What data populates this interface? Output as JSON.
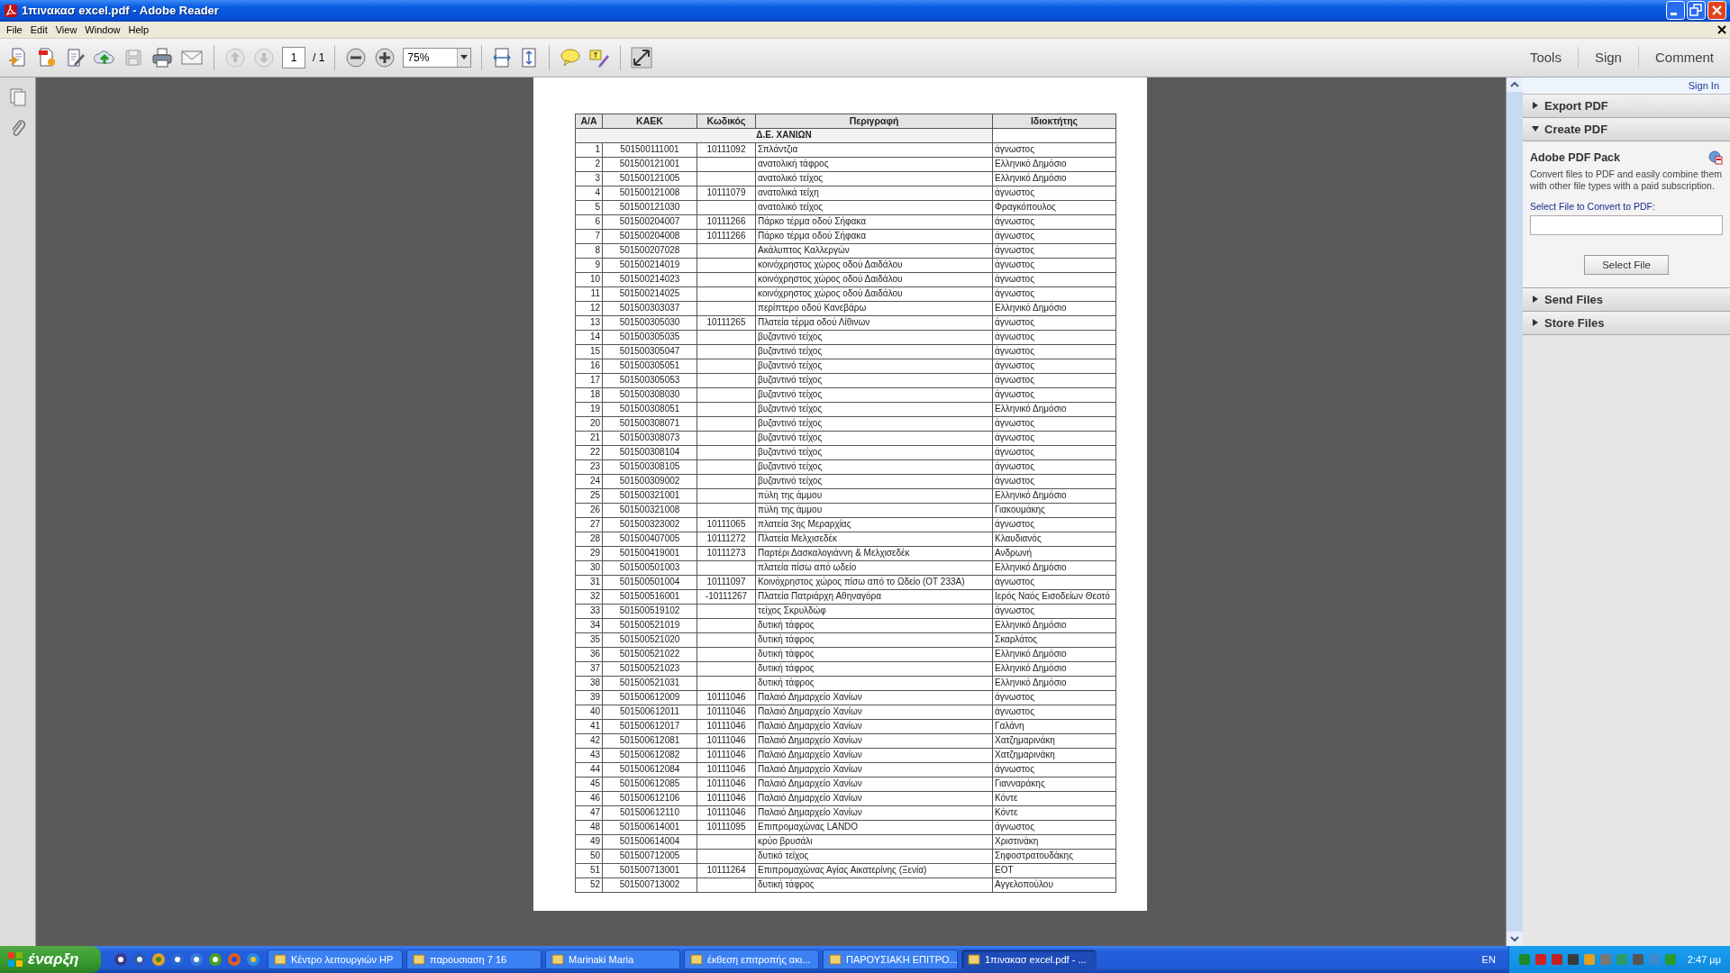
{
  "window": {
    "title": "1πινακασ excel.pdf - Adobe Reader"
  },
  "menu": [
    "File",
    "Edit",
    "View",
    "Window",
    "Help"
  ],
  "toolbar": {
    "page": "1",
    "page_count": "/ 1",
    "zoom": "75%",
    "tabs": [
      "Tools",
      "Sign",
      "Comment"
    ]
  },
  "document": {
    "columns": [
      "Α/Α",
      "ΚΑΕΚ",
      "Κωδικός",
      "Περιγραφή",
      "Ιδιοκτήτης"
    ],
    "group": "Δ.Ε. ΧΑΝΙΩΝ",
    "rows": [
      {
        "n": "1",
        "kaek": "501500111001",
        "code": "10111092",
        "desc": "Σπλάντζια",
        "owner": "άγνωστος"
      },
      {
        "n": "2",
        "kaek": "501500121001",
        "desc": "ανατολική τάφρος",
        "owner": "Ελληνικό Δημόσιο"
      },
      {
        "n": "3",
        "kaek": "501500121005",
        "desc": "ανατολικό τείχος",
        "owner": "Ελληνικό Δημόσιο"
      },
      {
        "n": "4",
        "kaek": "501500121008",
        "code": "10111079",
        "desc": "ανατολικά τείχη",
        "owner": "άγνωστος"
      },
      {
        "n": "5",
        "kaek": "501500121030",
        "desc": "ανατολικό τείχος",
        "owner": "Φραγκόπουλος"
      },
      {
        "n": "6",
        "kaek": "501500204007",
        "code": "10111266",
        "desc": "Πάρκο τέρμα οδού Σήφακα",
        "owner": "άγνωστος"
      },
      {
        "n": "7",
        "kaek": "501500204008",
        "code": "10111266",
        "desc": "Πάρκο τέρμα οδού Σήφακα",
        "owner": "άγνωστος"
      },
      {
        "n": "8",
        "kaek": "501500207028",
        "desc": "Ακάλυπτος Καλλεργών",
        "owner": "άγνωστος"
      },
      {
        "n": "9",
        "kaek": "501500214019",
        "desc": "κοινόχρηστος χώρος οδού Δαιδάλου",
        "owner": "άγνωστος"
      },
      {
        "n": "10",
        "kaek": "501500214023",
        "desc": "κοινόχρηστος χώρος οδού Δαιδάλου",
        "owner": "άγνωστος"
      },
      {
        "n": "11",
        "kaek": "501500214025",
        "desc": "κοινόχρηστος χώρος οδού Δαιδάλου",
        "owner": "άγνωστος"
      },
      {
        "n": "12",
        "kaek": "501500303037",
        "desc": "περίπτερο οδού Κανεβάρω",
        "owner": "Ελληνικό Δημόσιο"
      },
      {
        "n": "13",
        "kaek": "501500305030",
        "code": "10111265",
        "desc": "Πλατεία τέρμα οδού Λίθινων",
        "owner": "άγνωστος"
      },
      {
        "n": "14",
        "kaek": "501500305035",
        "desc": "βυζαντινό τείχος",
        "owner": "άγνωστος"
      },
      {
        "n": "15",
        "kaek": "501500305047",
        "desc": "βυζαντινό τείχος",
        "owner": "άγνωστος"
      },
      {
        "n": "16",
        "kaek": "501500305051",
        "desc": "βυζαντινό τείχος",
        "owner": "άγνωστος"
      },
      {
        "n": "17",
        "kaek": "501500305053",
        "desc": "βυζαντινό τείχος",
        "owner": "άγνωστος"
      },
      {
        "n": "18",
        "kaek": "501500308030",
        "desc": "βυζαντινό τείχος",
        "owner": "άγνωστος"
      },
      {
        "n": "19",
        "kaek": "501500308051",
        "desc": "βυζαντινό τείχος",
        "owner": "Ελληνικό Δημόσιο"
      },
      {
        "n": "20",
        "kaek": "501500308071",
        "desc": "βυζαντινό τείχος",
        "owner": "άγνωστος"
      },
      {
        "n": "21",
        "kaek": "501500308073",
        "desc": "βυζαντινό τείχος",
        "owner": "άγνωστος"
      },
      {
        "n": "22",
        "kaek": "501500308104",
        "desc": "βυζαντινό τείχος",
        "owner": "άγνωστος"
      },
      {
        "n": "23",
        "kaek": "501500308105",
        "desc": "βυζαντινό τείχος",
        "owner": "άγνωστος"
      },
      {
        "n": "24",
        "kaek": "501500309002",
        "desc": "βυζαντινό τείχος",
        "owner": "άγνωστος"
      },
      {
        "n": "25",
        "kaek": "501500321001",
        "desc": "πύλη της άμμου",
        "owner": "Ελληνικό Δημόσιο"
      },
      {
        "n": "26",
        "kaek": "501500321008",
        "desc": "πύλη της άμμου",
        "owner": "Γιακουμάκης"
      },
      {
        "n": "27",
        "kaek": "501500323002",
        "code": "10111065",
        "desc": "πλατεία 3ης Μεραρχίας",
        "owner": "άγνωστος"
      },
      {
        "n": "28",
        "kaek": "501500407005",
        "code": "10111272",
        "desc": "Πλατεία Μελχισεδέκ",
        "owner": "Κλαυδιανός"
      },
      {
        "n": "29",
        "kaek": "501500419001",
        "code": "10111273",
        "desc": "Παρτέρι Δασκαλογιάννη & Μελχισεδέκ",
        "owner": "Ανδρωνή"
      },
      {
        "n": "30",
        "kaek": "501500501003",
        "desc": "πλατεία πίσω από ωδείο",
        "owner": "Ελληνικό Δημόσιο"
      },
      {
        "n": "31",
        "kaek": "501500501004",
        "code": "10111097",
        "desc": "Κοινόχρηστος χώρος πίσω από το Ωδείο (ΟΤ 233Α)",
        "owner": "άγνωστος"
      },
      {
        "n": "32",
        "kaek": "501500516001",
        "code": "-10111267",
        "desc": "Πλατεία Πατριάρχη Αθηναγόρα",
        "owner": "Ιερός Ναός Εισοδείων Θεοτό"
      },
      {
        "n": "33",
        "kaek": "501500519102",
        "desc": "τείχος Σκρυλδώφ",
        "owner": "άγνωστος"
      },
      {
        "n": "34",
        "kaek": "501500521019",
        "desc": "δυτική τάφρος",
        "owner": "Ελληνικό Δημόσιο"
      },
      {
        "n": "35",
        "kaek": "501500521020",
        "desc": "δυτική τάφρος",
        "owner": "Σκαρλάτος"
      },
      {
        "n": "36",
        "kaek": "501500521022",
        "desc": "δυτική τάφρος",
        "owner": "Ελληνικό Δημόσιο"
      },
      {
        "n": "37",
        "kaek": "501500521023",
        "desc": "δυτική τάφρος",
        "owner": "Ελληνικό Δημόσιο"
      },
      {
        "n": "38",
        "kaek": "501500521031",
        "desc": "δυτική τάφρος",
        "owner": "Ελληνικό Δημόσιο"
      },
      {
        "n": "39",
        "kaek": "501500612009",
        "code": "10111046",
        "desc": "Παλαιό Δημαρχείο Χανίων",
        "owner": "άγνωστος"
      },
      {
        "n": "40",
        "kaek": "501500612011",
        "code": "10111046",
        "desc": "Παλαιό Δημαρχείο Χανίων",
        "owner": "άγνωστος"
      },
      {
        "n": "41",
        "kaek": "501500612017",
        "code": "10111046",
        "desc": "Παλαιό Δημαρχείο Χανίων",
        "owner": "Γαλάνη"
      },
      {
        "n": "42",
        "kaek": "501500612081",
        "code": "10111046",
        "desc": "Παλαιό Δημαρχείο Χανίων",
        "owner": "Χατζημαρινάκη"
      },
      {
        "n": "43",
        "kaek": "501500612082",
        "code": "10111046",
        "desc": "Παλαιό Δημαρχείο Χανίων",
        "owner": "Χατζημαρινάκη"
      },
      {
        "n": "44",
        "kaek": "501500612084",
        "code": "10111046",
        "desc": "Παλαιό Δημαρχείο Χανίων",
        "owner": "άγνωστος"
      },
      {
        "n": "45",
        "kaek": "501500612085",
        "code": "10111046",
        "desc": "Παλαιό Δημαρχείο Χανίων",
        "owner": "Γιανναράκης"
      },
      {
        "n": "46",
        "kaek": "501500612106",
        "code": "10111046",
        "desc": "Παλαιό Δημαρχείο Χανίων",
        "owner": "Κόντε"
      },
      {
        "n": "47",
        "kaek": "501500612110",
        "code": "10111046",
        "desc": "Παλαιό Δημαρχείο Χανίων",
        "owner": "Κόντε"
      },
      {
        "n": "48",
        "kaek": "501500614001",
        "code": "10111095",
        "desc": "Επιπρομαχώνας LANDO",
        "owner": "άγνωστος"
      },
      {
        "n": "49",
        "kaek": "501500614004",
        "desc": "κρύο βρυσάλι",
        "owner": "Χριστινάκη"
      },
      {
        "n": "50",
        "kaek": "501500712005",
        "desc": "δυτικό τείχος",
        "owner": "Σηφοστρατουδάκης"
      },
      {
        "n": "51",
        "kaek": "501500713001",
        "code": "10111264",
        "desc": "Επιπρομαχώνας Αγίας Αικατερίνης (Ξενία)",
        "owner": "ΕΟΤ"
      },
      {
        "n": "52",
        "kaek": "501500713002",
        "desc": "δυτική τάφρος",
        "owner": "Αγγελοπούλου"
      }
    ]
  },
  "pane": {
    "sign_in": "Sign In",
    "sections": [
      {
        "title": "Export PDF",
        "expanded": false
      },
      {
        "title": "Create PDF",
        "expanded": true,
        "heading": "Adobe PDF Pack",
        "description": "Convert files to PDF and easily combine them with other file types with a paid subscription.",
        "field_label": "Select File to Convert to PDF:",
        "button": "Select File"
      },
      {
        "title": "Send Files",
        "expanded": false
      },
      {
        "title": "Store Files",
        "expanded": false
      }
    ]
  },
  "taskbar": {
    "start": "έναρξη",
    "tasks": [
      {
        "label": "Κέντρο λειτουργιών HP",
        "selected": false
      },
      {
        "label": "παρουσιαση 7 16",
        "selected": false
      },
      {
        "label": "Marinaki Maria",
        "selected": false
      },
      {
        "label": "έκθεση επιτροπής ακι...",
        "selected": false
      },
      {
        "label": "ΠΑΡΟΥΣΙΑΚΗ ΕΠΙΤΡΟ...",
        "selected": false
      },
      {
        "label": "1πινακασ excel.pdf - ...",
        "selected": true
      }
    ],
    "language": "EN",
    "clock": "2:47 μμ"
  }
}
